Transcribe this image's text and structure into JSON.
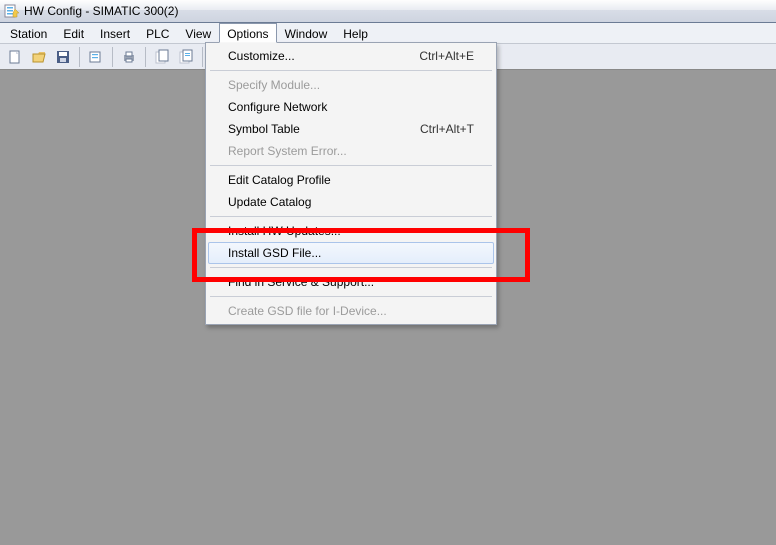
{
  "window": {
    "title": "HW Config - SIMATIC 300(2)"
  },
  "menubar": {
    "items": [
      "Station",
      "Edit",
      "Insert",
      "PLC",
      "View",
      "Options",
      "Window",
      "Help"
    ],
    "open_index": 5
  },
  "toolbar": {
    "buttons": [
      "new",
      "open",
      "save",
      "",
      "properties",
      "",
      "print",
      "",
      "cut",
      "copy",
      "paste",
      "",
      "download",
      "upload"
    ]
  },
  "dropdown": {
    "groups": [
      [
        {
          "label": "Customize...",
          "accel": "Ctrl+Alt+E",
          "disabled": false
        }
      ],
      [
        {
          "label": "Specify Module...",
          "disabled": true
        },
        {
          "label": "Configure Network",
          "disabled": false
        },
        {
          "label": "Symbol Table",
          "accel": "Ctrl+Alt+T",
          "disabled": false
        },
        {
          "label": "Report System Error...",
          "disabled": true
        }
      ],
      [
        {
          "label": "Edit Catalog Profile",
          "disabled": false
        },
        {
          "label": "Update Catalog",
          "disabled": false
        }
      ],
      [
        {
          "label": "Install HW Updates...",
          "disabled": false
        },
        {
          "label": "Install GSD File...",
          "disabled": false,
          "highlight": true
        }
      ],
      [
        {
          "label": "Find in Service & Support...",
          "disabled": false
        }
      ],
      [
        {
          "label": "Create GSD file for I-Device...",
          "disabled": true
        }
      ]
    ]
  }
}
